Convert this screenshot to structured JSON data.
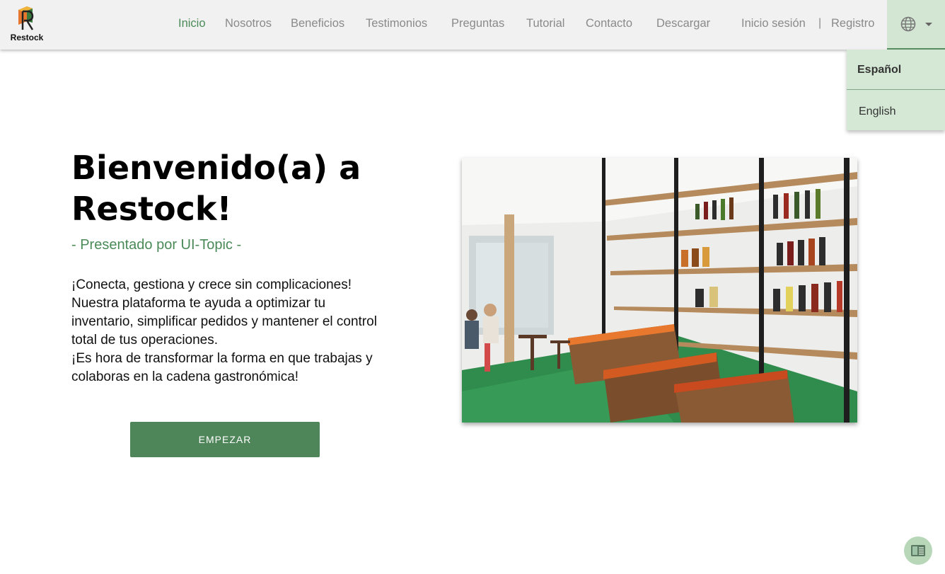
{
  "header": {
    "logo_text": "Restock",
    "nav": [
      {
        "label": "Inicio",
        "active": true
      },
      {
        "label": "Nosotros"
      },
      {
        "label": "Beneficios"
      },
      {
        "label": "Testimonios"
      },
      {
        "label": "Preguntas"
      },
      {
        "label": "Tutorial"
      },
      {
        "label": "Contacto"
      },
      {
        "label": "Descargar"
      }
    ],
    "login": "Inicio sesión",
    "separator": "|",
    "register": "Registro",
    "language_icon": "globe-icon"
  },
  "language_menu": {
    "selected": "Español",
    "other": "English"
  },
  "hero": {
    "title": "Bienvenido(a) a Restock!",
    "subtitle": "- Presentado por UI-Topic -",
    "description_lines": [
      "¡Conecta, gestiona y crece sin complicaciones!",
      "Nuestra plataforma te ayuda a optimizar tu",
      "inventario, simplificar pedidos y mantener el control",
      "total de tus operaciones.",
      "¡Es hora de transformar la forma en que trabajas y",
      "colaboras en la cadena gastronómica!"
    ],
    "cta": "EMPEZAR"
  },
  "colors": {
    "accent": "#4a8a57",
    "button": "#4e8559",
    "menu_bg": "#d5e8d5",
    "header_bg": "#f1f1f1"
  },
  "floating": {
    "icon": "reader-mode-icon"
  }
}
